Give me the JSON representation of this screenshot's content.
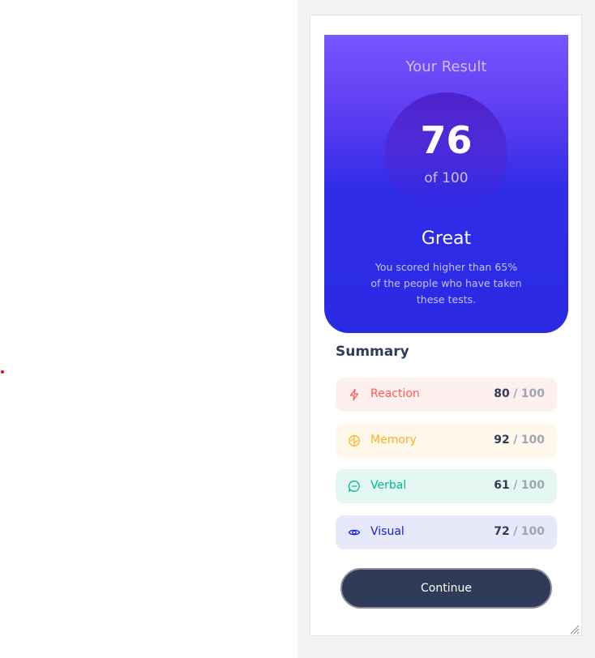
{
  "result": {
    "heading": "Your Result",
    "score": "76",
    "score_total": "of 100",
    "grade": "Great",
    "description": "You scored higher than 65% of the people who have taken these tests."
  },
  "summary": {
    "title": "Summary",
    "items": [
      {
        "label": "Reaction",
        "score": "80",
        "max": "100",
        "color": "#ff5757",
        "bg": "#fff0f0",
        "icon": "lightning-icon"
      },
      {
        "label": "Memory",
        "score": "92",
        "max": "100",
        "color": "#ffb01f",
        "bg": "#fff8eb",
        "icon": "brain-icon"
      },
      {
        "label": "Verbal",
        "score": "61",
        "max": "100",
        "color": "#00bb8f",
        "bg": "#e5f7f3",
        "icon": "chat-bubble-icon"
      },
      {
        "label": "Visual",
        "score": "72",
        "max": "100",
        "color": "#1125d4",
        "bg": "#e7e8fa",
        "icon": "eye-icon"
      }
    ],
    "separator": "/"
  },
  "continue_label": "Continue"
}
